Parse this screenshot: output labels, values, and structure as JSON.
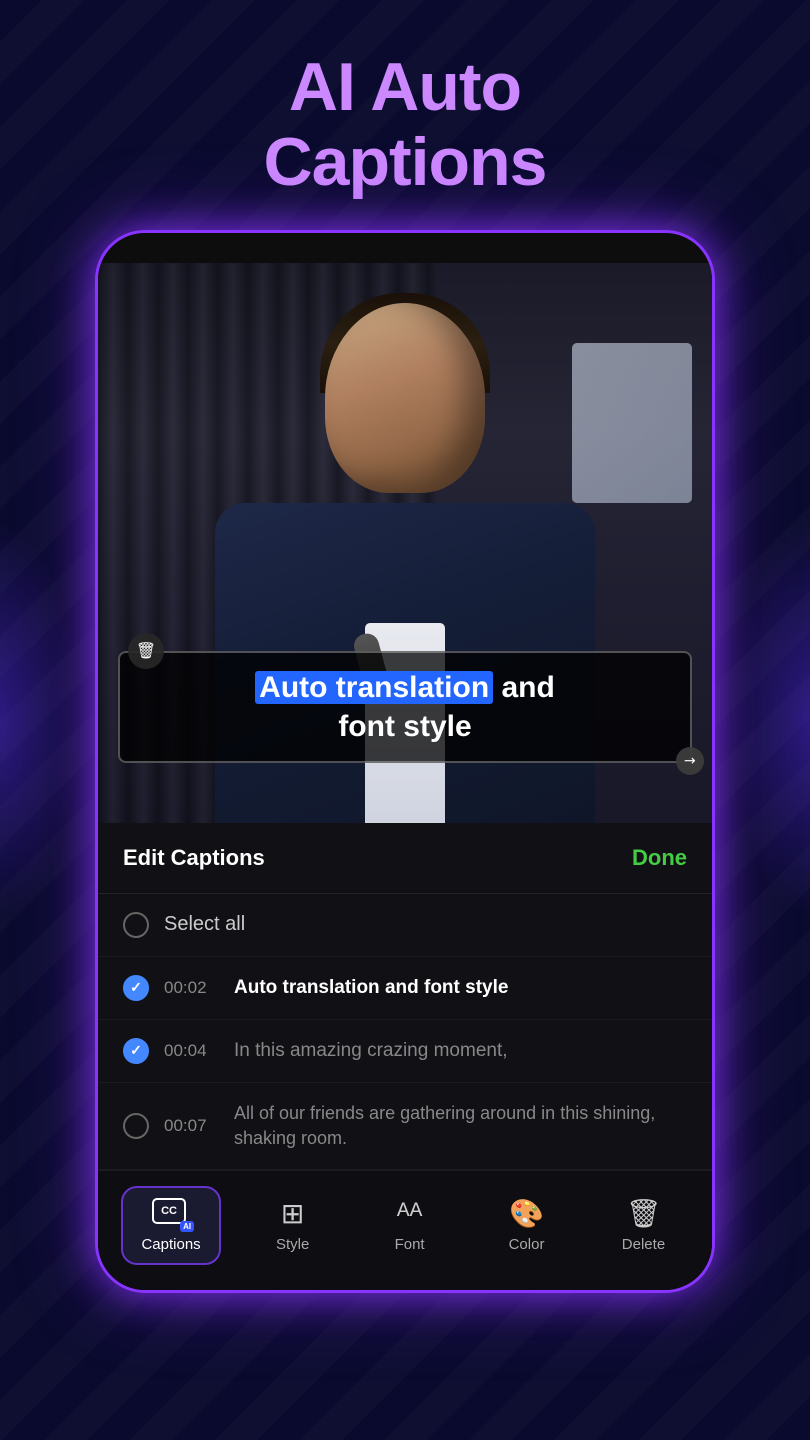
{
  "page": {
    "background_color": "#0a0a2e"
  },
  "title": {
    "line1": "AI Auto",
    "line2": "Captions"
  },
  "caption_overlay": {
    "text_part1": "Auto translation",
    "text_part2": " and",
    "text_line2": "font style",
    "delete_icon": "🗑",
    "resize_icon": "↗"
  },
  "edit_captions_header": {
    "label": "Edit Captions",
    "done_button": "Done"
  },
  "select_all": {
    "label": "Select all",
    "checked": false
  },
  "caption_items": [
    {
      "id": 1,
      "checked": true,
      "timestamp": "00:02",
      "text": "Auto translation and font style",
      "highlighted": true
    },
    {
      "id": 2,
      "checked": true,
      "timestamp": "00:04",
      "text": "In this amazing crazing moment,",
      "highlighted": false
    },
    {
      "id": 3,
      "checked": false,
      "timestamp": "00:07",
      "text": "All of our friends are gathering around in this shining, shaking room.",
      "highlighted": false,
      "multiline": true
    }
  ],
  "toolbar": {
    "items": [
      {
        "id": "captions",
        "label": "Captions",
        "icon": "cc",
        "active": true
      },
      {
        "id": "style",
        "label": "Style",
        "icon": "style",
        "active": false
      },
      {
        "id": "font",
        "label": "Font",
        "icon": "font",
        "active": false
      },
      {
        "id": "color",
        "label": "Color",
        "icon": "color",
        "active": false
      },
      {
        "id": "delete",
        "label": "Delete",
        "icon": "delete",
        "active": false
      }
    ]
  }
}
